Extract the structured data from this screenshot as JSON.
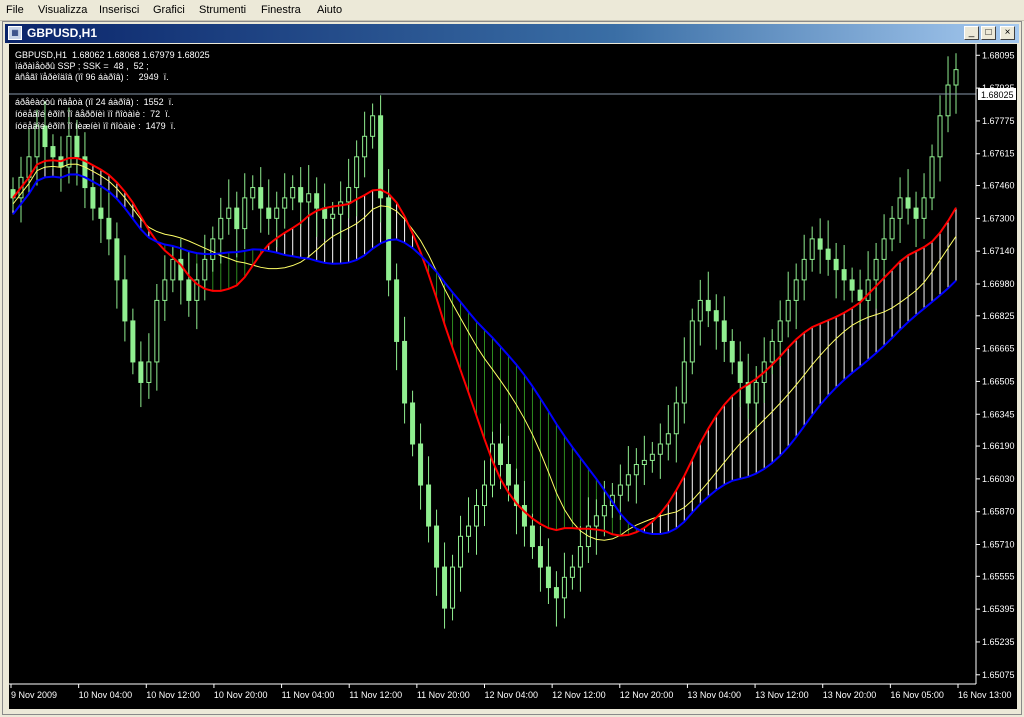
{
  "menu": {
    "items": [
      "File",
      "Visualizza",
      "Inserisci",
      "Grafici",
      "Strumenti",
      "Finestra",
      "Aiuto"
    ]
  },
  "window": {
    "title": "GBPUSD,H1",
    "icon": "chart-window-icon",
    "controls": {
      "minimize": "_",
      "maximize": "□",
      "close": "×"
    }
  },
  "info": {
    "line1": "GBPUSD,H1  1.68062 1.68068 1.67979 1.68025",
    "line2": "ïáðàìåòðû SSP ; SSK =  48 ,  52 ;",
    "line3": "âñåãî ïåðèîäîâ (ïî 96 áàðîâ) :    2949  ï.",
    "line4": "áðåêàóòû ñâåòà (ïî 24 áàðîâ) :  1552  ï.",
    "line5": "íóëåâîé êðîñ ïî âåðõíèì ïî ñîòàìè :  72  ï.",
    "line6": "íóëåâîé êðîñ ïî íèæíèì ïî ñîòàìè :  1479  ï."
  },
  "chart_data": {
    "type": "candlestick",
    "symbol": "GBPUSD",
    "timeframe": "H1",
    "ohlc_last": {
      "open": 1.68062,
      "high": 1.68068,
      "low": 1.67979,
      "close": 1.68025
    },
    "current_price_label": "1.68025",
    "y_ticks": [
      "1.68095",
      "1.67935",
      "1.67775",
      "1.67615",
      "1.67460",
      "1.67300",
      "1.67140",
      "1.66980",
      "1.66825",
      "1.66665",
      "1.66505",
      "1.66345",
      "1.66190",
      "1.66030",
      "1.65870",
      "1.65710",
      "1.65555",
      "1.65395",
      "1.65235",
      "1.65075"
    ],
    "ylim": [
      1.6503,
      1.6815
    ],
    "x_ticks": [
      "9 Nov 2009",
      "10 Nov 04:00",
      "10 Nov 12:00",
      "10 Nov 20:00",
      "11 Nov 04:00",
      "11 Nov 12:00",
      "11 Nov 20:00",
      "12 Nov 04:00",
      "12 Nov 12:00",
      "12 Nov 20:00",
      "13 Nov 04:00",
      "13 Nov 12:00",
      "13 Nov 20:00",
      "16 Nov 05:00",
      "16 Nov 13:00"
    ],
    "candle_color": "#90ee90",
    "colors": {
      "background": "#000000",
      "red_line": "#ff0000",
      "blue_line": "#0000ff",
      "yellow_line": "#ffff66",
      "white_hatch": "#ffffff",
      "green_hatch": "#2e8b20",
      "axis_text": "#ffffff"
    },
    "closes": [
      1.674,
      1.675,
      1.676,
      1.6775,
      1.6765,
      1.676,
      1.6755,
      1.677,
      1.676,
      1.6745,
      1.6735,
      1.673,
      1.672,
      1.67,
      1.668,
      1.666,
      1.665,
      1.666,
      1.669,
      1.67,
      1.671,
      1.67,
      1.669,
      1.67,
      1.671,
      1.672,
      1.673,
      1.6735,
      1.6725,
      1.674,
      1.6745,
      1.6735,
      1.673,
      1.6735,
      1.674,
      1.6745,
      1.6738,
      1.6742,
      1.6735,
      1.673,
      1.6732,
      1.6738,
      1.6745,
      1.676,
      1.677,
      1.678,
      1.674,
      1.67,
      1.667,
      1.664,
      1.662,
      1.66,
      1.658,
      1.656,
      1.654,
      1.656,
      1.6575,
      1.658,
      1.659,
      1.66,
      1.662,
      1.661,
      1.66,
      1.659,
      1.658,
      1.657,
      1.656,
      1.655,
      1.6545,
      1.6555,
      1.656,
      1.657,
      1.658,
      1.6585,
      1.659,
      1.6595,
      1.66,
      1.6605,
      1.661,
      1.6612,
      1.6615,
      1.662,
      1.6625,
      1.664,
      1.666,
      1.668,
      1.669,
      1.6685,
      1.668,
      1.667,
      1.666,
      1.665,
      1.664,
      1.665,
      1.666,
      1.667,
      1.668,
      1.669,
      1.67,
      1.671,
      1.672,
      1.6715,
      1.671,
      1.6705,
      1.67,
      1.6695,
      1.669,
      1.67,
      1.671,
      1.672,
      1.673,
      1.674,
      1.6735,
      1.673,
      1.674,
      1.676,
      1.678,
      1.6795,
      1.68025
    ]
  }
}
